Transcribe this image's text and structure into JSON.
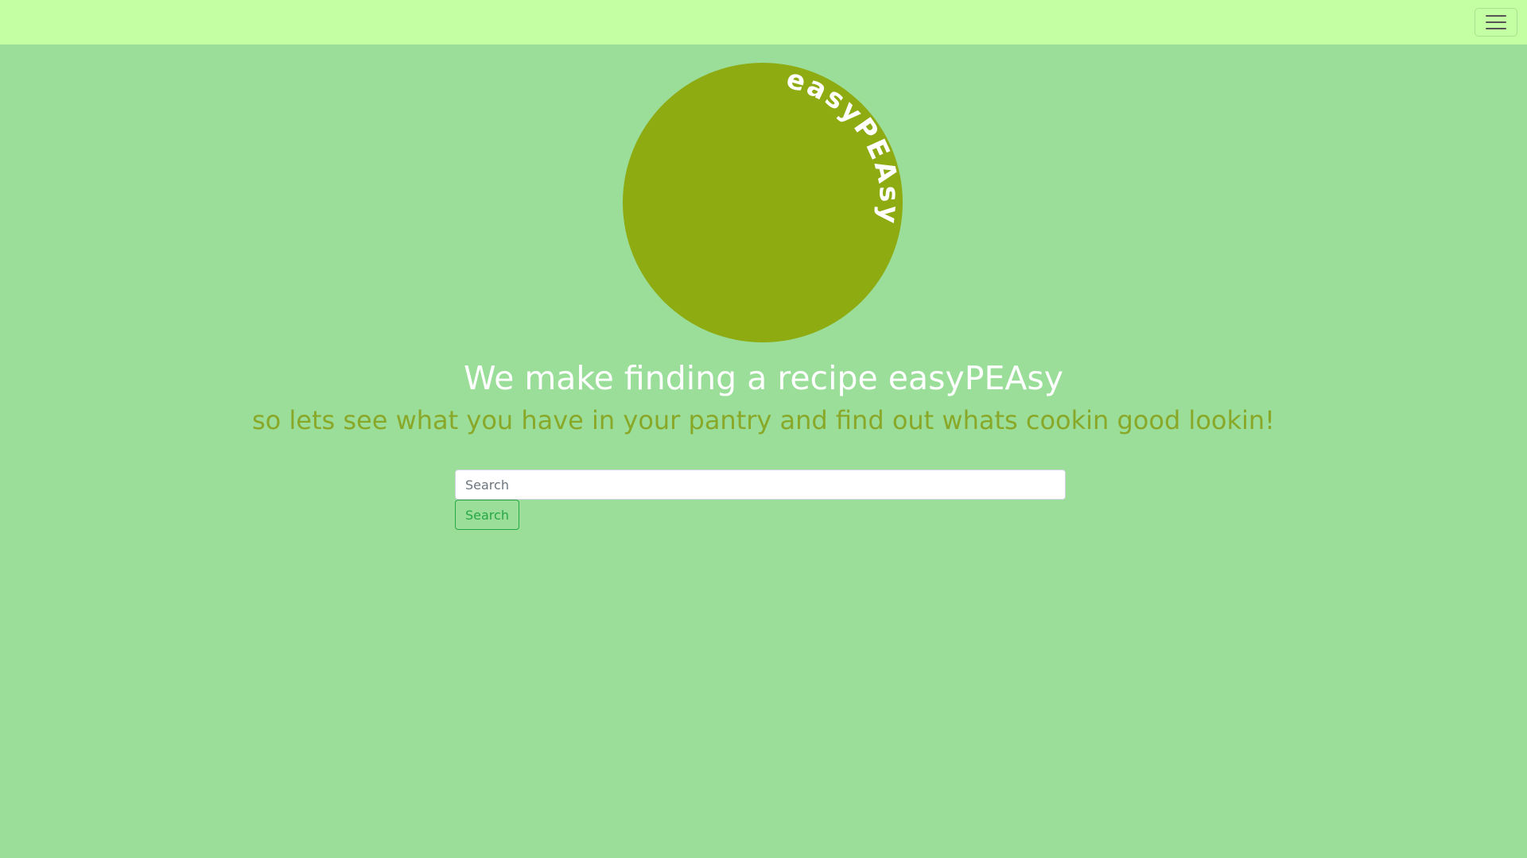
{
  "navbar": {
    "background": "#c4ffa4",
    "toggler_icon": "hamburger-icon"
  },
  "logo": {
    "text": "easyPEAsy",
    "circle_color": "#8fab12",
    "text_color": "#ffffff"
  },
  "hero": {
    "headline": "We make finding a recipe easyPEAsy",
    "subline": "so lets see what you have in your pantry and find out whats cookin good lookin!",
    "headline_color": "#ffffff",
    "subline_color": "#8aa828"
  },
  "search": {
    "input_value": "",
    "placeholder": "Search",
    "button_label": "Search",
    "button_color": "#28a745"
  },
  "page": {
    "background": "#9ade9a"
  }
}
